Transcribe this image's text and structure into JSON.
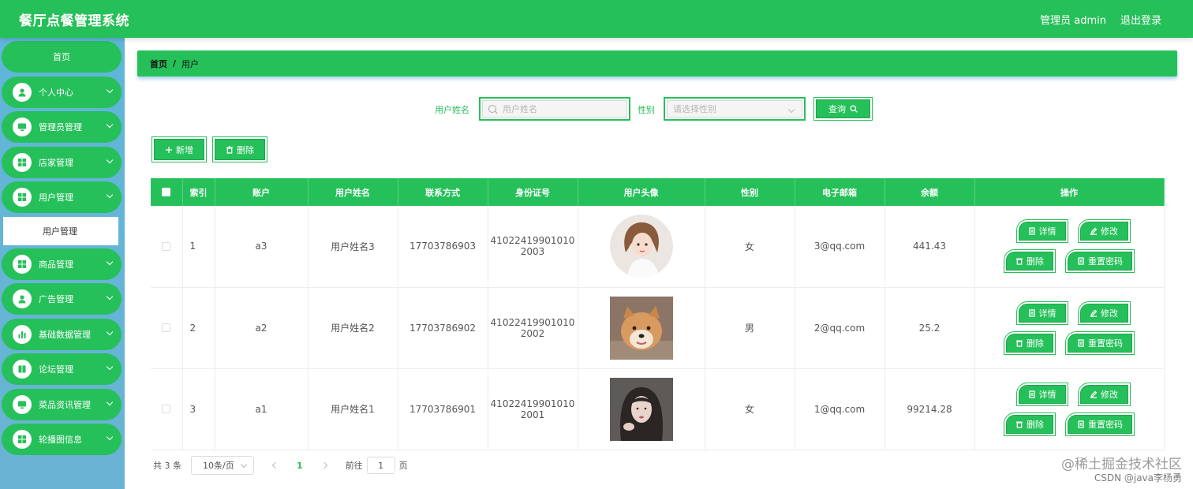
{
  "header": {
    "title": "餐厅点餐管理系统",
    "user": "管理员 admin",
    "logout": "退出登录"
  },
  "sidebar": {
    "home": "首页",
    "items": [
      {
        "label": "个人中心",
        "icon": "user-icon"
      },
      {
        "label": "管理员管理",
        "icon": "monitor-icon"
      },
      {
        "label": "店家管理",
        "icon": "grid-icon"
      },
      {
        "label": "用户管理",
        "icon": "grid-icon"
      },
      {
        "label": "商品管理",
        "icon": "grid-icon"
      },
      {
        "label": "广告管理",
        "icon": "user-icon"
      },
      {
        "label": "基础数据管理",
        "icon": "chart-icon"
      },
      {
        "label": "论坛管理",
        "icon": "book-icon"
      },
      {
        "label": "菜品资讯管理",
        "icon": "monitor-icon"
      },
      {
        "label": "轮播图信息",
        "icon": "grid-icon"
      }
    ],
    "active_sub": "用户管理"
  },
  "breadcrumb": {
    "home": "首页",
    "sep": "/",
    "current": "用户"
  },
  "search": {
    "name_label": "用户姓名",
    "name_placeholder": "用户姓名",
    "gender_label": "性别",
    "gender_placeholder": "请选择性别",
    "query_button": "查询"
  },
  "actions": {
    "add": "新增",
    "delete": "删除"
  },
  "table": {
    "columns": [
      "索引",
      "账户",
      "用户姓名",
      "联系方式",
      "身份证号",
      "用户头像",
      "性别",
      "电子邮箱",
      "余额",
      "操作"
    ],
    "rows": [
      {
        "index": "1",
        "account": "a3",
        "name": "用户姓名3",
        "phone": "17703786903",
        "id_line1": "41022419901010",
        "id_line2": "2003",
        "gender": "女",
        "email": "3@qq.com",
        "balance": "441.43",
        "avatar": "cartoon-girl-portrait"
      },
      {
        "index": "2",
        "account": "a2",
        "name": "用户姓名2",
        "phone": "17703786902",
        "id_line1": "41022419901010",
        "id_line2": "2002",
        "gender": "男",
        "email": "2@qq.com",
        "balance": "25.2",
        "avatar": "shiba-dog-photo"
      },
      {
        "index": "3",
        "account": "a1",
        "name": "用户姓名1",
        "phone": "17703786901",
        "id_line1": "41022419901010",
        "id_line2": "2001",
        "gender": "女",
        "email": "1@qq.com",
        "balance": "99214.28",
        "avatar": "girl-photo"
      }
    ],
    "ops": {
      "detail": "详情",
      "edit": "修改",
      "delete": "删除",
      "reset": "重置密码"
    }
  },
  "pager": {
    "total": "共 3 条",
    "size": "10条/页",
    "page": "1",
    "goto": "前往",
    "goto_value": "1",
    "page_unit": "页"
  },
  "watermark": {
    "line1": "@稀土掘金技术社区",
    "line2": "CSDN @java李杨勇"
  },
  "colors": {
    "primary": "#26c05a",
    "sidebar": "#5fb6d8"
  }
}
